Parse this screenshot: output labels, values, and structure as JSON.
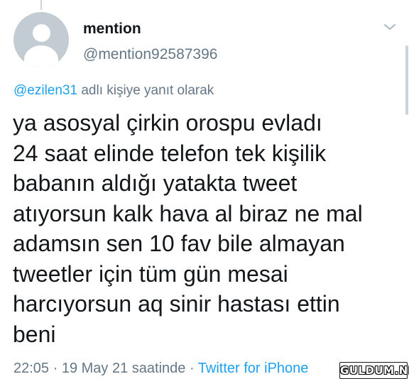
{
  "tweet": {
    "author_name": "mention",
    "author_handle": "@mention92587396",
    "reply_mention": "@ezilen31",
    "reply_suffix": " adlı kişiye yanıt olarak",
    "text_lines": [
      "ya asosyal çirkin orospu evladı",
      "24 saat elinde telefon tek kişilik",
      "babanın aldığı yatakta tweet",
      "atıyorsun kalk hava al biraz ne mal",
      "adamsın sen 10 fav bile almayan",
      "tweetler için tüm gün mesai",
      "harcıyorsun aq sinir hastası ettin",
      "beni"
    ],
    "timestamp": "22:05 · 19 May 21 saatinde · ",
    "client": "Twitter for iPhone"
  },
  "watermark": "GULDUM.NET",
  "icons": {
    "avatar": "default-avatar-icon",
    "menu": "chevron-down-icon"
  },
  "colors": {
    "link": "#1da1f2",
    "secondary_text": "#657786",
    "primary_text": "#14171a"
  }
}
